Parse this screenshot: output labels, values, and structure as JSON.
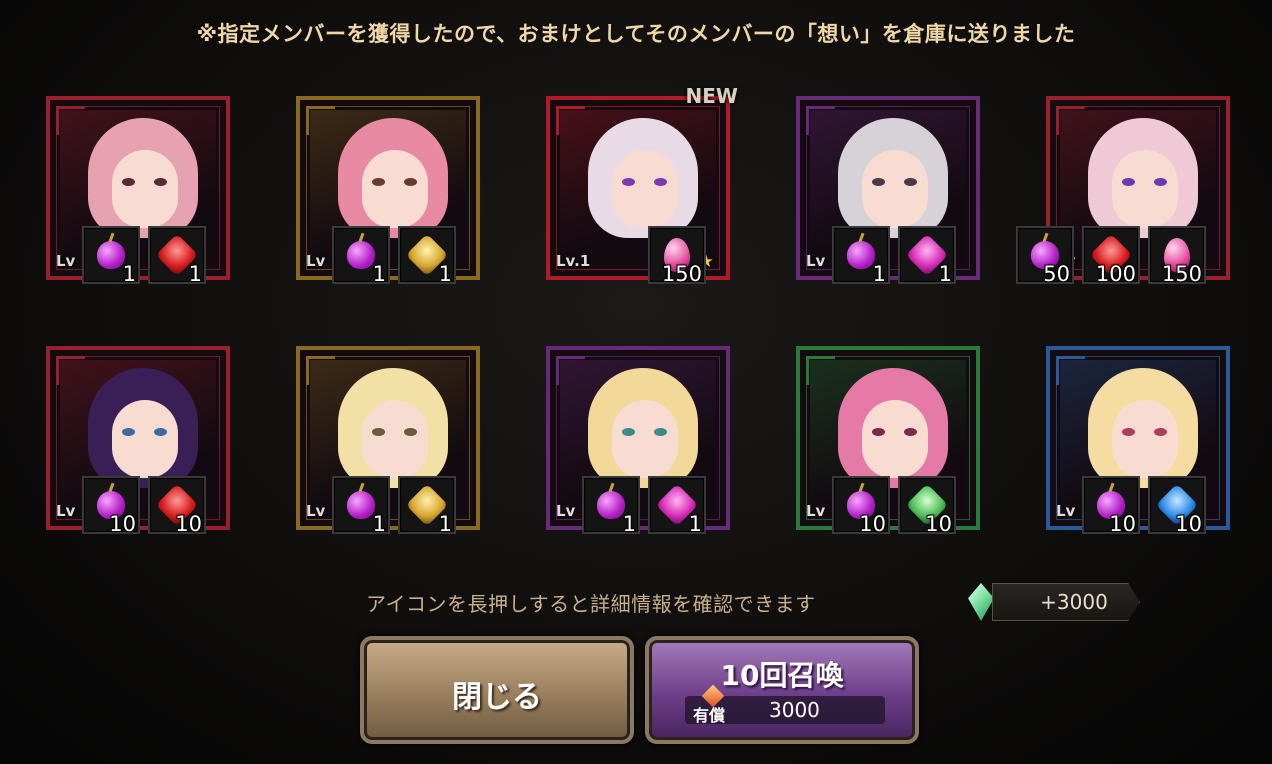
{
  "notice": "※指定メンバーを獲得したので、おまけとしてそのメンバーの「想い」を倉庫に送りました",
  "hint": "アイコンを長押しすると詳細情報を確認できます",
  "reward": {
    "value": "+3000",
    "icon": "green-crystal-icon"
  },
  "buttons": {
    "close": "閉じる",
    "summon": "10回召喚",
    "cost_label": "有償",
    "cost_value": "3000"
  },
  "members": [
    {
      "frame": "#9a2030",
      "hair": "#e7a2b2",
      "eye": "#5a2a3a",
      "lv": "Lv",
      "stars": "★",
      "new": "",
      "items": [
        {
          "icon": "apple-icon",
          "type": "apple",
          "count": "1"
        },
        {
          "icon": "red-spirit-icon",
          "type": "red",
          "count": "1"
        }
      ]
    },
    {
      "frame": "#8a6a20",
      "hair": "#e98aa4",
      "eye": "#6a3a2a",
      "lv": "Lv",
      "stars": "★",
      "new": "",
      "items": [
        {
          "icon": "apple-icon",
          "type": "apple",
          "count": "1"
        },
        {
          "icon": "gold-spirit-icon",
          "type": "gold",
          "count": "1"
        }
      ]
    },
    {
      "frame": "#b01a2a",
      "hair": "#e8dbe6",
      "eye": "#7a3ab0",
      "lv": "Lv.1",
      "stars": "★★★",
      "new": "NEW",
      "items": [
        {
          "icon": "pink-egg-icon",
          "type": "egg",
          "count": "150"
        }
      ]
    },
    {
      "frame": "#6a2a7a",
      "hair": "#d6d2d8",
      "eye": "#4a3a4a",
      "lv": "Lv",
      "stars": "★",
      "new": "",
      "items": [
        {
          "icon": "apple-icon",
          "type": "apple",
          "count": "1"
        },
        {
          "icon": "pink-spirit-icon",
          "type": "pink",
          "count": "1"
        }
      ]
    },
    {
      "frame": "#9a2030",
      "hair": "#f0c9d6",
      "eye": "#6a3ab0",
      "lv": "Lv",
      "stars": "★",
      "new": "",
      "items": [
        {
          "icon": "apple-icon",
          "type": "apple",
          "count": "50"
        },
        {
          "icon": "red-spirit-icon",
          "type": "red",
          "count": "100"
        },
        {
          "icon": "pink-egg-icon",
          "type": "egg",
          "count": "150"
        }
      ]
    },
    {
      "frame": "#9a2030",
      "hair": "#3a1e56",
      "eye": "#3a6aa0",
      "lv": "Lv",
      "stars": "★",
      "new": "",
      "items": [
        {
          "icon": "apple-icon",
          "type": "apple",
          "count": "10"
        },
        {
          "icon": "red-spirit-icon",
          "type": "red",
          "count": "10"
        }
      ]
    },
    {
      "frame": "#8a6a20",
      "hair": "#f3e0a6",
      "eye": "#6a5a3a",
      "lv": "Lv",
      "stars": "★",
      "new": "",
      "items": [
        {
          "icon": "apple-icon",
          "type": "apple",
          "count": "1"
        },
        {
          "icon": "gold-spirit-icon",
          "type": "gold",
          "count": "1"
        }
      ]
    },
    {
      "frame": "#6a2a7a",
      "hair": "#f2d99a",
      "eye": "#3a8a8a",
      "lv": "Lv",
      "stars": "★",
      "new": "",
      "items": [
        {
          "icon": "apple-icon",
          "type": "apple",
          "count": "1"
        },
        {
          "icon": "pink-spirit-icon",
          "type": "pink",
          "count": "1"
        }
      ]
    },
    {
      "frame": "#2a7a3a",
      "hair": "#e67aa6",
      "eye": "#7a2a4a",
      "lv": "Lv",
      "stars": "★",
      "new": "",
      "items": [
        {
          "icon": "apple-icon",
          "type": "apple",
          "count": "10"
        },
        {
          "icon": "green-spirit-icon",
          "type": "green",
          "count": "10"
        }
      ]
    },
    {
      "frame": "#2a5a9a",
      "hair": "#f5dca0",
      "eye": "#b03a5a",
      "lv": "Lv",
      "stars": "★",
      "new": "",
      "items": [
        {
          "icon": "apple-icon",
          "type": "apple",
          "count": "10"
        },
        {
          "icon": "blue-spirit-icon",
          "type": "blue",
          "count": "10"
        }
      ]
    }
  ]
}
